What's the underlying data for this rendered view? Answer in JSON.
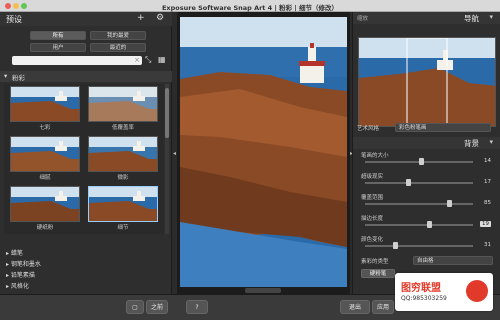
{
  "window": {
    "title": "Exposure Software Snap Art 4 | 粉彩 | 细节（修改）"
  },
  "presets_panel": {
    "title": "预设",
    "filters": [
      "所有",
      "我的最爱",
      "用户",
      "最近的"
    ],
    "selected_filter": "所有",
    "search_placeholder": "",
    "category_open": "粉彩",
    "thumbnails": [
      {
        "label": "七彩"
      },
      {
        "label": "低覆盖率"
      },
      {
        "label": "细腻"
      },
      {
        "label": "微影"
      },
      {
        "label": "硬纸粉"
      },
      {
        "label": "细节"
      }
    ],
    "selected_thumbnail": "细节",
    "categories": [
      "蜡笔",
      "钢笔和墨水",
      "铅笔素描",
      "风格化"
    ]
  },
  "navigator": {
    "title": "导航",
    "zoom_label": "缩放"
  },
  "art_style": {
    "label": "艺术风格",
    "value": "彩色粉笔画"
  },
  "background": {
    "title": "背景",
    "sliders": [
      {
        "label": "笔画的大小",
        "value": "14",
        "fraction": 0.52
      },
      {
        "label": "超级现实",
        "value": "17",
        "fraction": 0.4
      },
      {
        "label": "覆盖范围",
        "value": "85",
        "fraction": 0.8
      },
      {
        "label": "描边长度",
        "value": "19",
        "fraction": 0.6
      },
      {
        "label": "颜色变化",
        "value": "31",
        "fraction": 0.27
      }
    ],
    "paper_type_label": "素彩的类型",
    "paper_type_value": "自由格",
    "sketch_button": "硬粉笔"
  },
  "bottom_bar": {
    "compare_button": "之前",
    "help_icon": "?",
    "exit_button": "退出",
    "apply_button": "应用"
  },
  "watermark": {
    "title": "图穷联盟",
    "subtitle": "QQ:985303259"
  },
  "colors": {
    "sea": "#2b6aa8",
    "cliff": "#8a4a26",
    "sky": "#cfe0ee",
    "lighthouse": "#f3f1ea",
    "roof": "#b2342b"
  }
}
